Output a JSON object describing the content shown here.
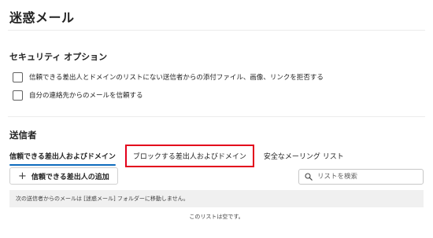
{
  "page": {
    "title": "迷惑メール"
  },
  "security_options": {
    "heading": "セキュリティ オプション",
    "options": [
      {
        "label": "信頼できる差出人とドメインのリストにない送信者からの添付ファイル、画像、リンクを拒否する",
        "checked": false
      },
      {
        "label": "自分の連絡先からのメールを信頼する",
        "checked": false
      }
    ]
  },
  "senders": {
    "heading": "送信者",
    "tabs": [
      {
        "label": "信頼できる差出人およびドメイン",
        "active": true
      },
      {
        "label": "ブロックする差出人およびドメイン",
        "active": false,
        "highlighted": true
      },
      {
        "label": "安全なメーリング リスト",
        "active": false
      }
    ],
    "add_button_label": "信頼できる差出人の追加",
    "search_placeholder": "リストを検索",
    "info_message": "次の送信者からのメールは [迷惑メール] フォルダーに移動しません。",
    "empty_message": "このリストは空です。"
  },
  "colors": {
    "accent": "#0f6cbd",
    "highlight_border": "#e3001b",
    "info_bar_bg": "#f0f0f0"
  },
  "icons": {
    "add": "plus-icon",
    "search": "search-icon"
  }
}
